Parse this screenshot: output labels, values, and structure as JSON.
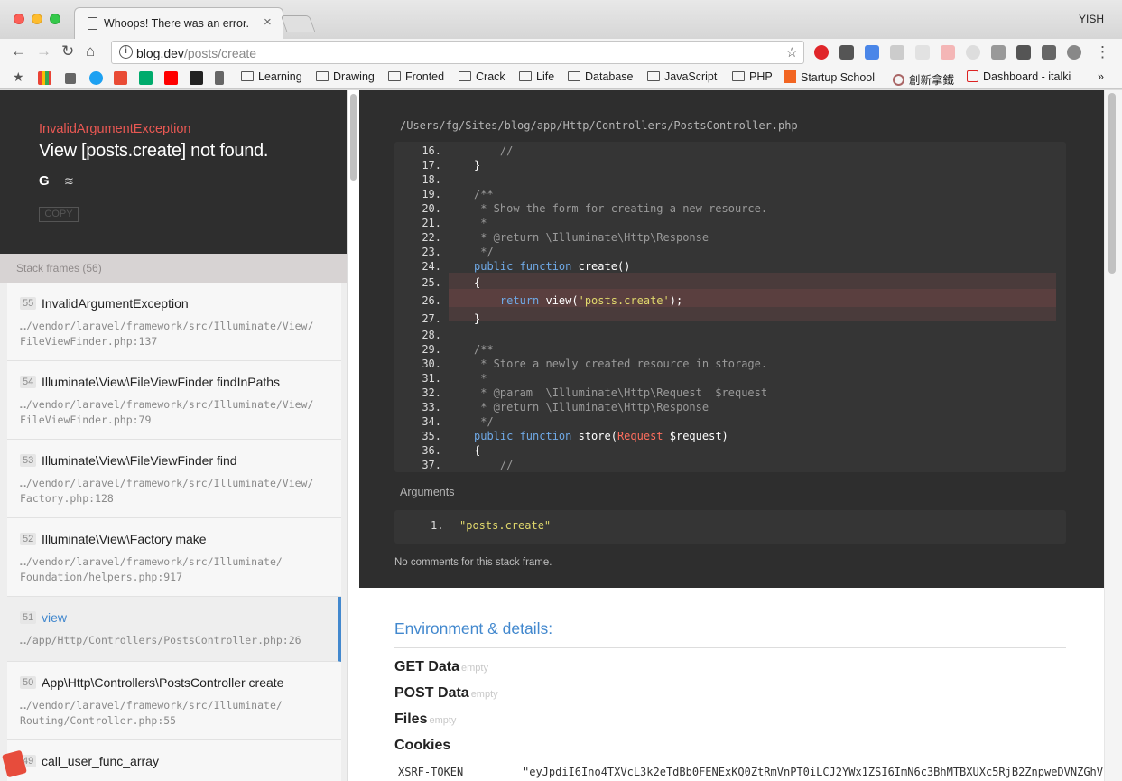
{
  "browser": {
    "tab_title": "Whoops! There was an error.",
    "tab_close": "×",
    "user": "YISH",
    "url_host": "blog.dev",
    "url_path": "/posts/create",
    "nav": {
      "back": "←",
      "forward": "→",
      "reload": "↻",
      "home": "⌂"
    },
    "star": "☆",
    "menu": "⋮",
    "bookmarks": [
      "Learning",
      "Drawing",
      "Fronted",
      "Crack",
      "Life",
      "Database",
      "JavaScript",
      "PHP",
      "Startup School",
      "創新拿鐵",
      "Dashboard - italki"
    ],
    "bookmarks_more": "»"
  },
  "error": {
    "class": "InvalidArgumentException",
    "message": "View [posts.create] not found.",
    "google_icon": "G",
    "stackoverflow_icon": "≋",
    "copy": "COPY"
  },
  "frames": {
    "title": "Stack frames (56)",
    "items": [
      {
        "num": "55",
        "name": "InvalidArgumentException",
        "file": "…/vendor/laravel/framework/src/Illuminate/View/ FileViewFinder.php:137"
      },
      {
        "num": "54",
        "name": "Illuminate\\View\\FileViewFinder findInPaths",
        "file": "…/vendor/laravel/framework/src/Illuminate/View/ FileViewFinder.php:79"
      },
      {
        "num": "53",
        "name": "Illuminate\\View\\FileViewFinder find",
        "file": "…/vendor/laravel/framework/src/Illuminate/View/ Factory.php:128"
      },
      {
        "num": "52",
        "name": "Illuminate\\View\\Factory make",
        "file": "…/vendor/laravel/framework/src/Illuminate/ Foundation/helpers.php:917"
      },
      {
        "num": "51",
        "name": "view",
        "file": "…/app/Http/Controllers/PostsController.php:26",
        "active": true
      },
      {
        "num": "50",
        "name": "App\\Http\\Controllers\\PostsController create",
        "file": "…/vendor/laravel/framework/src/Illuminate/ Routing/Controller.php:55"
      },
      {
        "num": "49",
        "name": "call_user_func_array",
        "file": ""
      }
    ]
  },
  "code": {
    "file_path": "/Users/fg/Sites/blog/app/Http/Controllers/PostsController.php",
    "highlight_lines": [
      "25.",
      "26.",
      "27."
    ],
    "current_line": "26.",
    "lines": [
      {
        "n": "16.",
        "t": "    //",
        "k": "cm"
      },
      {
        "n": "17.",
        "t": "}",
        "k": "fn"
      },
      {
        "n": "18.",
        "t": "",
        "k": "fn"
      },
      {
        "n": "19.",
        "t": "/**",
        "k": "cm"
      },
      {
        "n": "20.",
        "t": " * Show the form for creating a new resource.",
        "k": "cm"
      },
      {
        "n": "21.",
        "t": " *",
        "k": "cm"
      },
      {
        "n": "22.",
        "t": " * @return \\Illuminate\\Http\\Response",
        "k": "cm"
      },
      {
        "n": "23.",
        "t": " */",
        "k": "cm"
      },
      {
        "n": "24.",
        "t": "public function create()",
        "k": "decl"
      },
      {
        "n": "25.",
        "t": "{",
        "k": "fn"
      },
      {
        "n": "26.",
        "t": "    return view('posts.create');",
        "k": "ret"
      },
      {
        "n": "27.",
        "t": "}",
        "k": "fn"
      },
      {
        "n": "28.",
        "t": "",
        "k": "fn"
      },
      {
        "n": "29.",
        "t": "/**",
        "k": "cm"
      },
      {
        "n": "30.",
        "t": " * Store a newly created resource in storage.",
        "k": "cm"
      },
      {
        "n": "31.",
        "t": " *",
        "k": "cm"
      },
      {
        "n": "32.",
        "t": " * @param  \\Illuminate\\Http\\Request  $request",
        "k": "cm"
      },
      {
        "n": "33.",
        "t": " * @return \\Illuminate\\Http\\Response",
        "k": "cm"
      },
      {
        "n": "34.",
        "t": " */",
        "k": "cm"
      },
      {
        "n": "35.",
        "t": "public function store(Request $request)",
        "k": "store"
      },
      {
        "n": "36.",
        "t": "{",
        "k": "fn"
      },
      {
        "n": "37.",
        "t": "    //",
        "k": "cm"
      }
    ]
  },
  "arguments": {
    "title": "Arguments",
    "items": [
      {
        "index": "1.",
        "value": "\"posts.create\""
      }
    ]
  },
  "no_comments": "No comments for this stack frame.",
  "environment": {
    "title": "Environment & details:",
    "sections": [
      {
        "label": "GET Data",
        "note": "empty"
      },
      {
        "label": "POST Data",
        "note": "empty"
      },
      {
        "label": "Files",
        "note": "empty"
      },
      {
        "label": "Cookies",
        "note": ""
      }
    ],
    "cookie": {
      "key": "XSRF-TOKEN",
      "value": "\"eyJpdiI6Ino4TXVcL3k2eTdBb0FENExKQ0ZtRmVnPT0iLCJ2YWx1ZSI6ImN6c3BhMTBXUXc5RjB2ZnpweDVNZGhV"
    }
  }
}
